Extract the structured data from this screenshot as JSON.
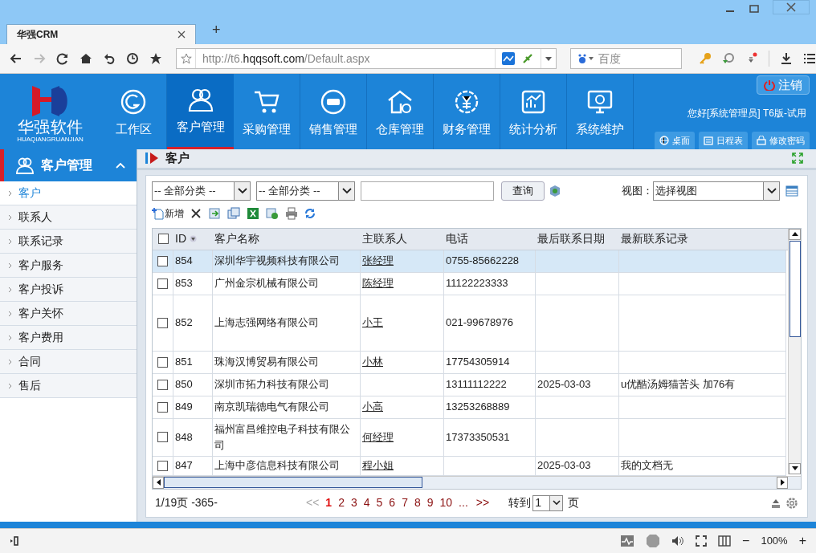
{
  "browser": {
    "tab_title": "华强CRM",
    "new_tab": "+",
    "url_prefix": "http://t6.",
    "url_host": "hqqsoft.com",
    "url_path": "/Default.aspx",
    "search_placeholder": "百度",
    "zoom": "100%",
    "zoom_minus": "−",
    "zoom_plus": "+"
  },
  "header": {
    "logo_text": "华强软件",
    "logo_sub": "HUAQIANGRUANJIAN",
    "logout": "注销",
    "greeting": "您好[系统管理员] T6版-试用",
    "nav": [
      {
        "kind": "workspace",
        "label": "工作区",
        "selected": false
      },
      {
        "kind": "customer",
        "label": "客户管理",
        "selected": true
      },
      {
        "kind": "purchase",
        "label": "采购管理",
        "selected": false
      },
      {
        "kind": "sales",
        "label": "销售管理",
        "selected": false
      },
      {
        "kind": "warehouse",
        "label": "仓库管理",
        "selected": false
      },
      {
        "kind": "finance",
        "label": "财务管理",
        "selected": false
      },
      {
        "kind": "stats",
        "label": "统计分析",
        "selected": false
      },
      {
        "kind": "system",
        "label": "系统维护",
        "selected": false
      }
    ],
    "quick": [
      {
        "kind": "desktop",
        "label": "桌面"
      },
      {
        "kind": "calendar",
        "label": "日程表"
      },
      {
        "kind": "password",
        "label": "修改密码"
      }
    ]
  },
  "sidebar": {
    "title": "客户管理",
    "items": [
      {
        "label": "客户",
        "selected": true
      },
      {
        "label": "联系人",
        "selected": false
      },
      {
        "label": "联系记录",
        "selected": false
      },
      {
        "label": "客户服务",
        "selected": false
      },
      {
        "label": "客户投诉",
        "selected": false
      },
      {
        "label": "客户关怀",
        "selected": false
      },
      {
        "label": "客户费用",
        "selected": false
      },
      {
        "label": "合同",
        "selected": false
      },
      {
        "label": "售后",
        "selected": false
      }
    ]
  },
  "panel": {
    "title": "客户",
    "filter1": "-- 全部分类 --",
    "filter2": "-- 全部分类 --",
    "query": "查询",
    "view_label": "视图：",
    "view_value": "选择视图",
    "new": "新增"
  },
  "table": {
    "all_checked": false,
    "columns": [
      "ID",
      "客户名称",
      "主联系人",
      "电话",
      "最后联系日期",
      "最新联系记录"
    ],
    "rows": [
      {
        "id": "854",
        "name": "深圳华宇视频科技有限公司",
        "contact": "张经理",
        "phone": "0755-85662228",
        "date": "",
        "record": "",
        "selected": true,
        "checked": false
      },
      {
        "id": "853",
        "name": "广州金宗机械有限公司",
        "contact": "陈经理",
        "phone": "11122223333",
        "date": "",
        "record": "",
        "selected": false,
        "checked": false
      },
      {
        "id": "852",
        "name": "上海志强网络有限公司",
        "contact": "小王",
        "phone": "021-99678976",
        "date": "",
        "record": "",
        "selected": false,
        "checked": false
      },
      {
        "id": "851",
        "name": "珠海汉博贸易有限公司",
        "contact": "小林",
        "phone": "17754305914",
        "date": "",
        "record": "",
        "selected": false,
        "checked": false
      },
      {
        "id": "850",
        "name": "深圳市拓力科技有限公司",
        "contact": "",
        "phone": "13111112222",
        "date": "2025-03-03",
        "record": "u优酷汤姆猫苦头 加76有",
        "selected": false,
        "checked": false
      },
      {
        "id": "849",
        "name": "南京凯瑞德电气有限公司",
        "contact": "小高",
        "phone": "13253268889",
        "date": "",
        "record": "",
        "selected": false,
        "checked": false
      },
      {
        "id": "848",
        "name": "福州富昌维控电子科技有限公司",
        "contact": "何经理",
        "phone": "17373350531",
        "date": "",
        "record": "",
        "selected": false,
        "checked": false
      },
      {
        "id": "847",
        "name": "上海中彦信息科技有限公司",
        "contact": "程小姐",
        "phone": "",
        "date": "2025-03-03",
        "record": "我的文档无",
        "selected": false,
        "checked": false
      }
    ]
  },
  "pager": {
    "summary": "1/19页 -365-",
    "first": "<<",
    "pages": [
      {
        "label": "1",
        "selected": true
      },
      {
        "label": "2",
        "selected": false
      },
      {
        "label": "3",
        "selected": false
      },
      {
        "label": "4",
        "selected": false
      },
      {
        "label": "5",
        "selected": false
      },
      {
        "label": "6",
        "selected": false
      },
      {
        "label": "7",
        "selected": false
      },
      {
        "label": "8",
        "selected": false
      },
      {
        "label": "9",
        "selected": false
      },
      {
        "label": "10",
        "selected": false
      }
    ],
    "ellipsis": "...",
    "last": ">>",
    "goto": "转到",
    "goto_value": "1",
    "page_unit": "页"
  }
}
